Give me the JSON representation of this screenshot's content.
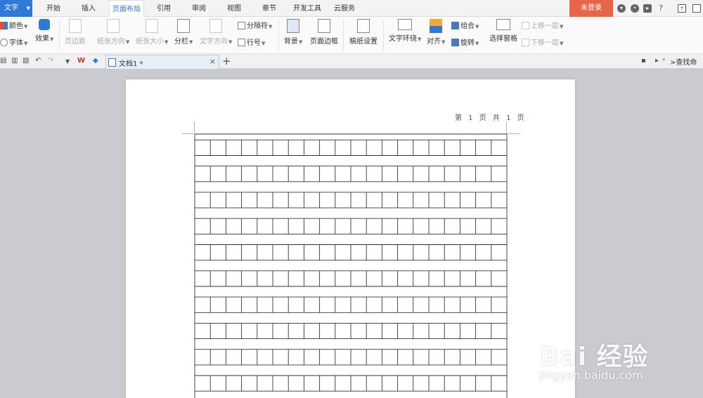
{
  "app": {
    "menu_label": "文字"
  },
  "menu": {
    "tabs": [
      "开始",
      "插入",
      "页面布局",
      "引用",
      "审阅",
      "视图",
      "章节",
      "开发工具",
      "云服务"
    ],
    "active_tab": "页面布局",
    "login_label": "未登录"
  },
  "ribbon": {
    "theme_colors": "颜色",
    "theme_fonts": "字体",
    "theme_effects": "效果",
    "margins": "页边距",
    "orientation": "纸张方向",
    "size": "纸张大小",
    "columns": "分栏",
    "text_direction": "文字方向",
    "breaks": "分隔符",
    "line_numbers": "行号",
    "background": "背景",
    "page_borders": "页面边框",
    "draft_paper": "稿纸设置",
    "text_wrap": "文字环绕",
    "align": "对齐",
    "group": "组合",
    "rotate": "旋转",
    "selection_pane": "选择窗格",
    "bring_forward": "上移一层",
    "send_backward": "下移一层"
  },
  "tabbar": {
    "document_name": "文档1 *",
    "find_label": ">查找命"
  },
  "document": {
    "header_text": "第 1 页 共 1 页",
    "grid_rows_visible": 10,
    "grid_columns": 20
  },
  "watermark": {
    "logo_text": "Bai 经验",
    "url": "jingyan.baidu.com"
  },
  "colors": {
    "accent": "#2f7ad8",
    "login": "#e8654a",
    "workspace": "#c9cbd0"
  }
}
